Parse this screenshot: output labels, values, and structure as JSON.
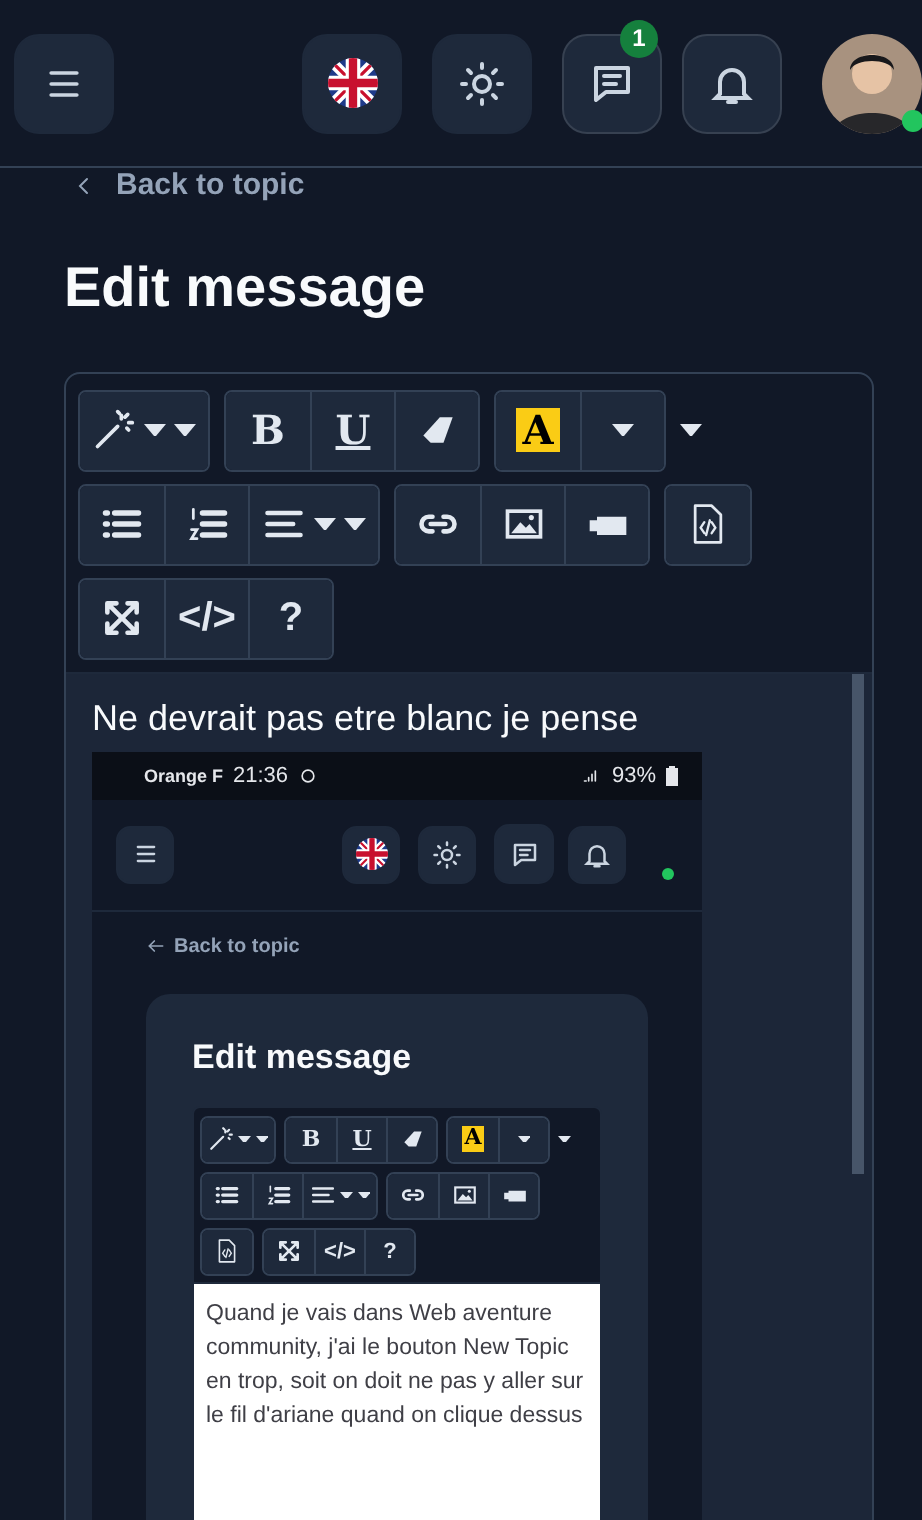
{
  "header": {
    "messages_badge": "1",
    "avatar_online": true
  },
  "back_link": "Back to topic",
  "title": "Edit message",
  "toolbar": {
    "bold": "B",
    "underline": "U",
    "highlight": "A",
    "source": "</>",
    "help": "?"
  },
  "content_text": "Ne devrait pas etre blanc je pense",
  "embedded_screenshot": {
    "carrier": "Orange F",
    "time": "21:36",
    "battery": "93%",
    "online": true,
    "back_link": "Back to topic",
    "title": "Edit message",
    "toolbar": {
      "bold": "B",
      "underline": "U",
      "highlight": "A",
      "source": "</>",
      "help": "?"
    },
    "content_text": "Quand je vais dans Web aventure community, j'ai le bouton New Topic en trop, soit on doit ne pas y aller sur le fil d'ariane quand on clique dessus"
  }
}
